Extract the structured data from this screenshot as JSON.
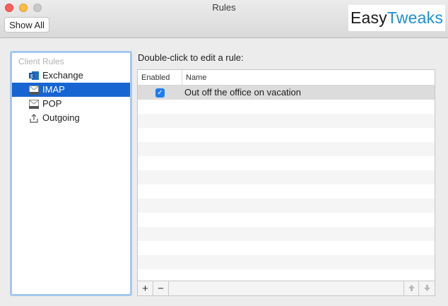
{
  "window": {
    "title": "Rules"
  },
  "toolbar": {
    "show_all_label": "Show All"
  },
  "logo": {
    "part1": "Easy",
    "part2": "Tweaks"
  },
  "sidebar": {
    "header": "Client Rules",
    "items": [
      {
        "label": "Exchange",
        "icon": "exchange-icon",
        "selected": false
      },
      {
        "label": "IMAP",
        "icon": "imap-icon",
        "selected": true
      },
      {
        "label": "POP",
        "icon": "pop-icon",
        "selected": false
      },
      {
        "label": "Outgoing",
        "icon": "outgoing-icon",
        "selected": false
      }
    ]
  },
  "main": {
    "instruction": "Double-click to edit a rule:",
    "columns": {
      "enabled": "Enabled",
      "name": "Name"
    },
    "rules": [
      {
        "enabled": true,
        "name": "Out off the office on vacation"
      }
    ]
  },
  "colors": {
    "selection": "#1765d3",
    "accent": "#1e7cf2",
    "brand_blue": "#1d8fd6"
  }
}
